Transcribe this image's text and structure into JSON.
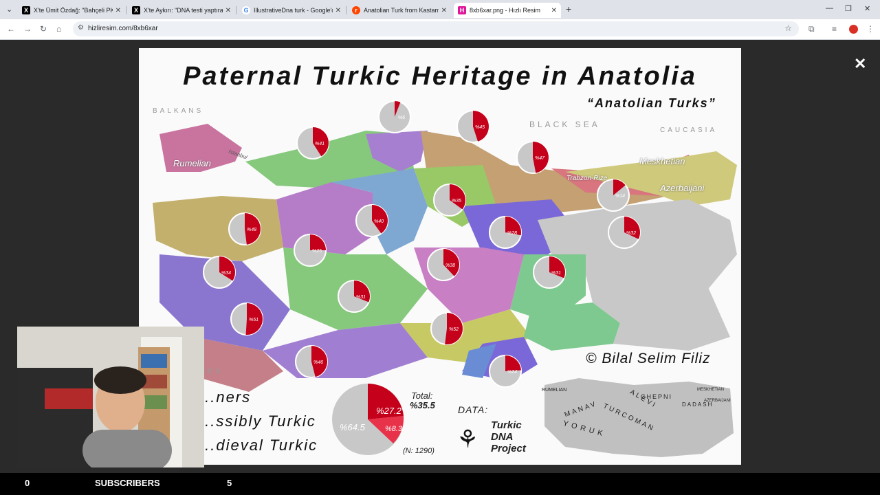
{
  "browser": {
    "tabs": [
      {
        "title": "X'te Ümit Özdağ: \"Bahçeli PKK'yı",
        "favicon": "X"
      },
      {
        "title": "X'te Aykırı: \"DNA testi yaptıran",
        "favicon": "X"
      },
      {
        "title": "IllustrativeDna turk - Google'da",
        "favicon": "G"
      },
      {
        "title": "Anatolian Turk from Kastamonu",
        "favicon": "r"
      },
      {
        "title": "8xb6xar.png - Hızlı Resim",
        "favicon": "H",
        "active": true
      }
    ],
    "url": "hizliresim.com/8xb6xar"
  },
  "map": {
    "title": "Paternal Turkic Heritage in Anatolia",
    "subtitle": "“Anatolian Turks”",
    "seas": [
      "BALKANS",
      "BLACK SEA",
      "CAUCASIA",
      "SEA"
    ],
    "regions": [
      "Rumelian",
      "Meskhetian",
      "Azerbaijani",
      "Trabzon-Rize",
      "Istanbul"
    ],
    "pies": [
      "%6",
      "%41",
      "%45",
      "%47",
      "%14",
      "%35",
      "%40",
      "%48",
      "%25",
      "%28",
      "%32",
      "%34",
      "%38",
      "%31",
      "%31",
      "%51",
      "%52",
      "%46",
      "%24"
    ],
    "copyright": "Bilal Selim Filiz",
    "legend": [
      "...ners",
      "...ssibly Turkic",
      "...dieval Turkic"
    ],
    "total_label": "Total:",
    "total_value": "%35.5",
    "big_pie": {
      "a": "%27.2",
      "b": "%8.3",
      "c": "%64.5"
    },
    "sample": "(N: 1290)",
    "data_label": "DATA:",
    "data_source": [
      "Turkic",
      "DNA",
      "Project"
    ],
    "inset_labels": [
      "RUMELIAN",
      "MANAV",
      "ALEVI",
      "CHEPNI",
      "TURCOMAN",
      "YORUK",
      "DADASH",
      "MESKHETIAN",
      "AZERBAIJANI"
    ]
  },
  "stream": {
    "left_count": "0",
    "subscribers_label": "SUBSCRIBERS",
    "right_count": "5"
  },
  "colors": {
    "pie_red": "#c4001a",
    "pie_light_red": "#e8324a",
    "pie_grey": "#c8c8c8"
  }
}
